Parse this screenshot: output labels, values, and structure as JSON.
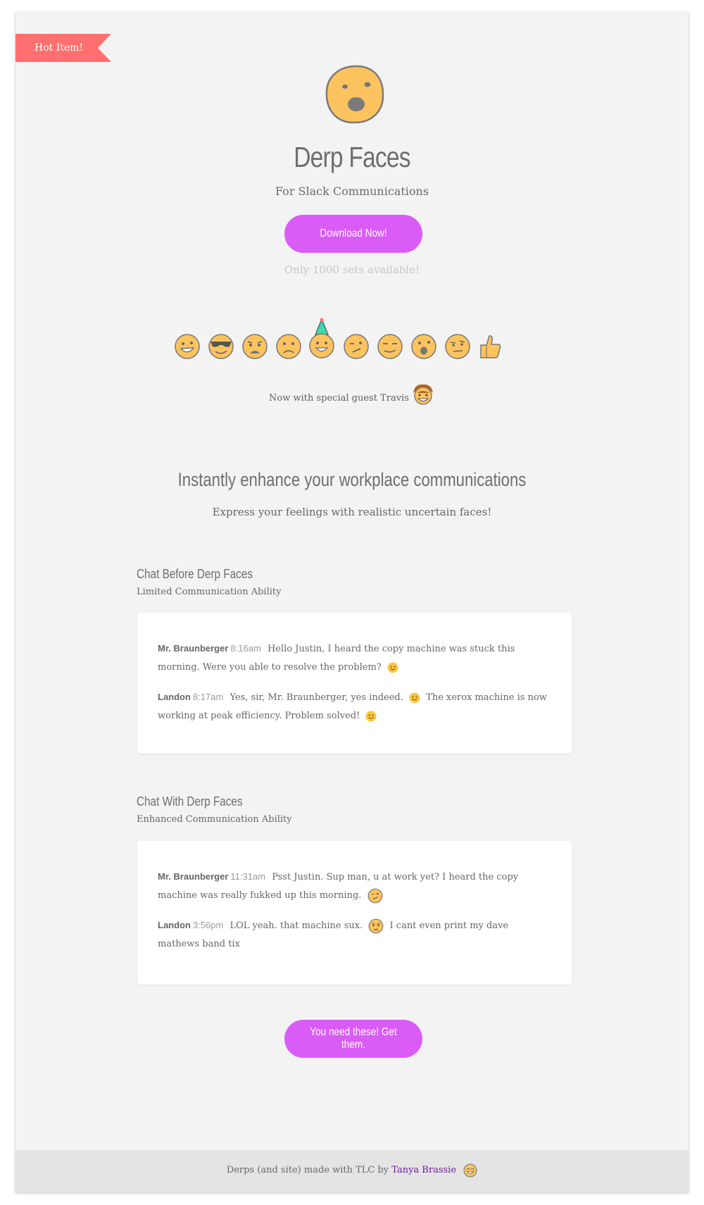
{
  "ribbon": {
    "label": "Hot Item!"
  },
  "hero": {
    "icon": "surprised-face-icon",
    "title": "Derp Faces",
    "subtitle": "For Slack Communications",
    "download_label": "Download Now!",
    "availability": "Only 1000 sets available!"
  },
  "emojis": [
    "grin-face-icon",
    "sunglasses-face-icon",
    "worried-face-icon",
    "frown-face-icon",
    "party-hat-face-icon",
    "wink-face-icon",
    "smirk-face-icon",
    "surprised-face-icon",
    "skeptical-face-icon",
    "thumbs-up-icon"
  ],
  "guest": {
    "text": "Now with special guest Travis",
    "icon": "travis-face-icon"
  },
  "section": {
    "title": "Instantly enhance your workplace communications",
    "subtitle": "Express your feelings with realistic uncertain faces!"
  },
  "chat_before": {
    "title": "Chat Before Derp Faces",
    "subtitle": "Limited Communication Ability",
    "messages": [
      {
        "name": "Mr. Braunberger",
        "time": "8:16am",
        "text": "Hello Justin, I heard the copy machine was stuck this morning. Were you able to resolve the problem?"
      },
      {
        "name": "Landon",
        "time": "8:17am",
        "text": "Yes, sir, Mr. Braunberger, yes indeed.",
        "text2": "The xerox machine is now working at peak efficiency. Problem solved!"
      }
    ]
  },
  "chat_after": {
    "title": "Chat With Derp Faces",
    "subtitle": "Enhanced Communication Ability",
    "messages": [
      {
        "name": "Mr. Braunberger",
        "time": "11:31am",
        "text": "Psst Justin. Sup man, u at work yet? I heard the copy machine was really fukked up this morning."
      },
      {
        "name": "Landon",
        "time": "3:56pm",
        "text": "LOL yeah. that machine sux.",
        "text2": "I cant even print my dave mathews band tix"
      }
    ]
  },
  "cta": {
    "label": "You need these! Get them."
  },
  "footer": {
    "text": "Derps (and site) made with TLC by",
    "author": "Tanya Brassie",
    "icon": "smile-face-icon"
  },
  "colors": {
    "accent": "#da5cf7",
    "ribbon": "#ff6f6f",
    "face": "#fdc35e",
    "background": "#f3f3f4"
  }
}
